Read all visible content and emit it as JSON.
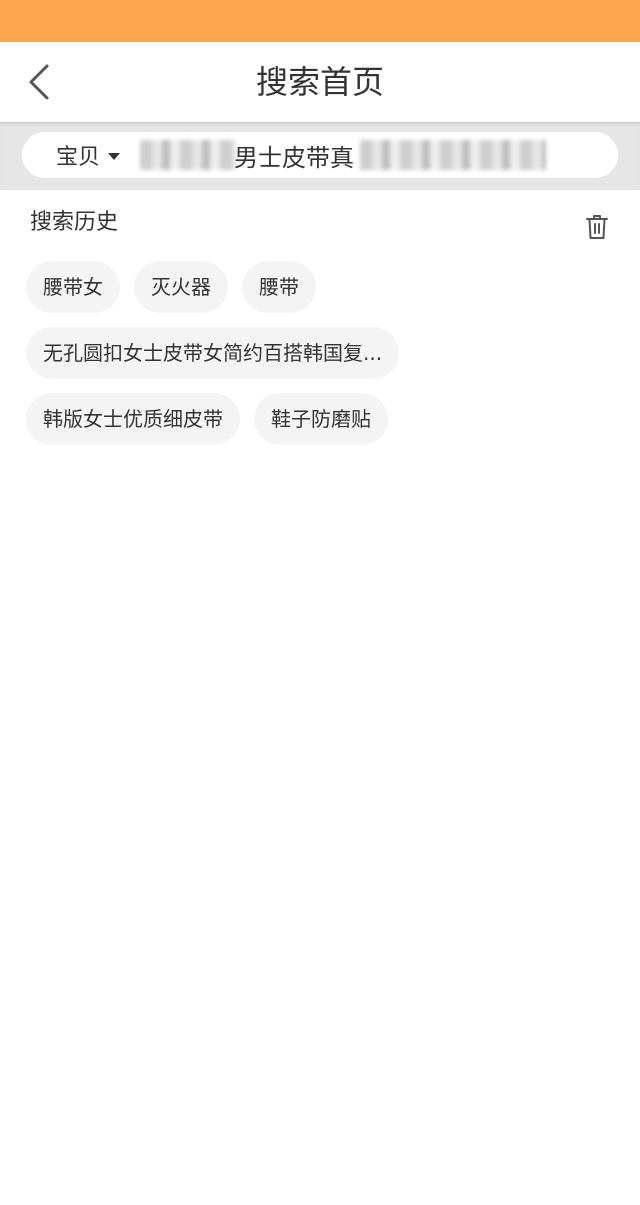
{
  "header": {
    "title": "搜索首页",
    "back_icon": "chevron-left-icon"
  },
  "search": {
    "scope_label": "宝贝",
    "query": "男士皮带真"
  },
  "history": {
    "title": "搜索历史",
    "delete_icon": "trash-icon",
    "rows": [
      [
        "腰带女",
        "灭火器",
        "腰带"
      ],
      [
        "无孔圆扣女士皮带女简约百搭韩国复..."
      ],
      [
        "韩版女士优质细皮带",
        "鞋子防磨贴"
      ]
    ]
  },
  "colors": {
    "status_bar": "#fca64e",
    "search_area": "#e6e6e6",
    "tag_bg": "#f4f4f4",
    "text": "#333333"
  }
}
